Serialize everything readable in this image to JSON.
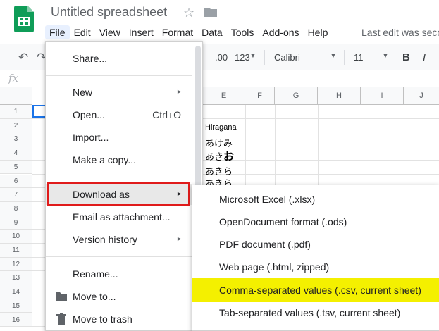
{
  "app": {
    "title": "Untitled spreadsheet",
    "last_edit": "Last edit was seco",
    "menu": [
      "File",
      "Edit",
      "View",
      "Insert",
      "Format",
      "Data",
      "Tools",
      "Add-ons",
      "Help"
    ]
  },
  "toolbar": {
    "decimal_label": ".00",
    "number_format_label": "123",
    "font": "Calibri",
    "font_size": "11",
    "bold": "B"
  },
  "formula": {
    "fx": "fx"
  },
  "grid": {
    "columns": [
      "E",
      "F",
      "G",
      "H",
      "I",
      "J"
    ],
    "rows": [
      "1",
      "2",
      "3",
      "4",
      "5",
      "6",
      "7",
      "8",
      "9",
      "10",
      "11",
      "12",
      "13",
      "14",
      "15",
      "16"
    ],
    "cells": {
      "e2": "Hiragana",
      "e3": "あけみ",
      "e4_prefix": "あき",
      "e4_bold": "お",
      "e5": "あきら",
      "e6": "あきら"
    }
  },
  "file_menu": {
    "share": "Share...",
    "new": "New",
    "open": "Open...",
    "open_shortcut": "Ctrl+O",
    "import": "Import...",
    "make_copy": "Make a copy...",
    "download_as": "Download as",
    "email_attachment": "Email as attachment...",
    "version_history": "Version history",
    "rename": "Rename...",
    "move_to": "Move to...",
    "move_to_trash": "Move to trash"
  },
  "download_submenu": {
    "items": [
      "Microsoft Excel (.xlsx)",
      "OpenDocument format (.ods)",
      "PDF document (.pdf)",
      "Web page (.html, zipped)",
      "Comma-separated values (.csv, current sheet)",
      "Tab-separated values (.tsv, current sheet)"
    ]
  },
  "colors": {
    "highlight_yellow": "#f4f000",
    "annotation_red": "#e01b1b",
    "sheets_green": "#0f9d58"
  }
}
